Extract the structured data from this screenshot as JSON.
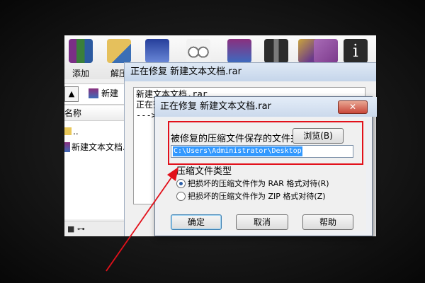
{
  "toolbar": {
    "buttons": [
      {
        "label": "添加"
      },
      {
        "label": "解压"
      },
      {
        "label": ""
      },
      {
        "label": ""
      },
      {
        "label": ""
      },
      {
        "label": ""
      },
      {
        "label": ""
      },
      {
        "label": ""
      },
      {
        "label": ""
      }
    ]
  },
  "address": {
    "path_label": "新建"
  },
  "list": {
    "column_name": "名称",
    "rows": [
      {
        "name": ".."
      },
      {
        "name": "新建文本文档."
      }
    ]
  },
  "repair_window": {
    "title": "正在修复 新建文本文档.rar",
    "log": [
      "新建文本文档.rar",
      "正在查",
      "--->"
    ]
  },
  "dialog": {
    "title": "正在修复 新建文本文档.rar",
    "close_label": "✕",
    "save_folder_label": "被修复的压缩文件保存的文件夹",
    "browse_label": "浏览(B)",
    "save_path": "C:\\Users\\Administrator\\Desktop",
    "type_group_label": "压缩文件类型",
    "options": [
      {
        "label": "把损坏的压缩文件作为 RAR 格式对待(R)",
        "selected": true
      },
      {
        "label": "把损坏的压缩文件作为 ZIP 格式对待(Z)",
        "selected": false
      }
    ],
    "ok_label": "确定",
    "cancel_label": "取消",
    "help_label": "帮助"
  },
  "colors": {
    "highlight": "#e2101a",
    "selection": "#3399ff"
  }
}
